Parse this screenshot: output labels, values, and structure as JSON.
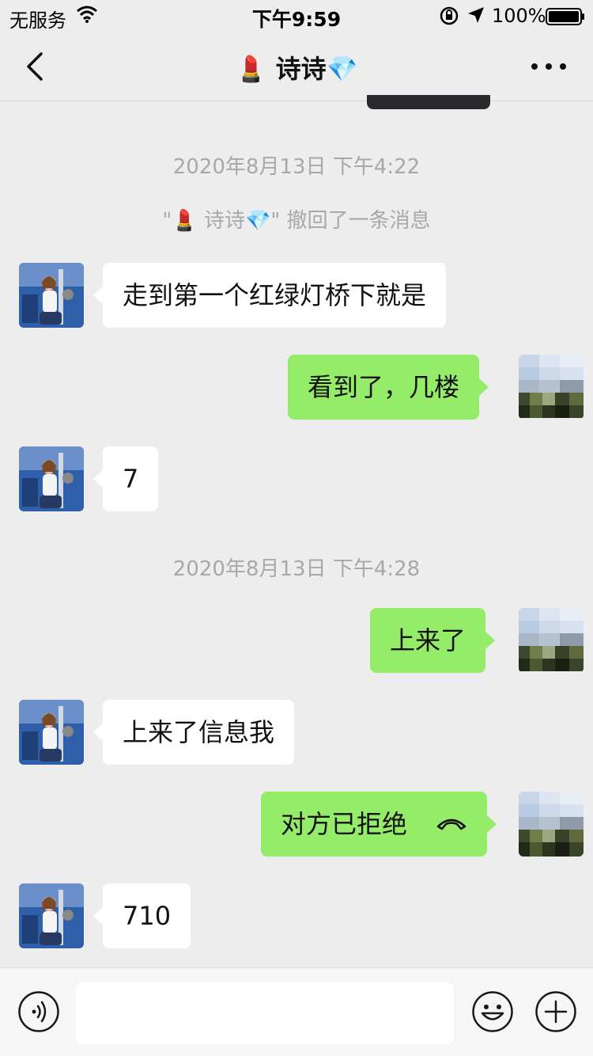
{
  "status_bar": {
    "carrier": "无服务",
    "time": "下午9:59",
    "battery": "100%"
  },
  "nav": {
    "title": "💄 诗诗💎"
  },
  "messages": {
    "ts1": "2020年8月13日 下午4:22",
    "recall_notice": "\"💄 诗诗💎\" 撤回了一条消息",
    "m1": "走到第一个红绿灯桥下就是",
    "m2": "看到了，几楼",
    "m3": "7",
    "ts2": "2020年8月13日 下午4:28",
    "m4": "上来了",
    "m5": "上来了信息我",
    "m6": "对方已拒绝",
    "m7": "710"
  },
  "input_bar": {
    "value": ""
  },
  "colors": {
    "background": "#ededed",
    "bubble_sent": "#95ec69",
    "bubble_received": "#ffffff",
    "timestamp_text": "#a8a8a8"
  },
  "icons": {
    "back": "chevron-left-icon",
    "more": "more-dots-icon",
    "voice": "voice-icon",
    "emoji": "emoji-icon",
    "plus": "plus-icon",
    "call": "hangup-phone-icon"
  }
}
